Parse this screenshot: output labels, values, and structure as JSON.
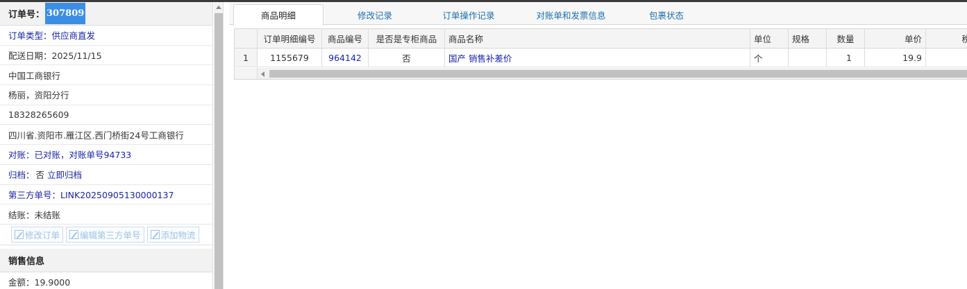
{
  "order": {
    "label": "订单号：",
    "number": "307809"
  },
  "info": [
    {
      "text": "订单类型：供应商直发",
      "style": "blue"
    },
    {
      "text": "配送日期：2025/11/15",
      "style": "normal"
    },
    {
      "text": "中国工商银行",
      "style": "normal"
    },
    {
      "text": "杨丽，资阳分行",
      "style": "normal"
    },
    {
      "text": "18328265609",
      "style": "normal"
    },
    {
      "text": "四川省.资阳市.雁江区.西门桥街24号工商银行",
      "style": "normal"
    },
    {
      "text": "对账：已对账，对账单号94733",
      "style": "blue"
    }
  ],
  "archive": {
    "label": "归档：",
    "value": "否",
    "link": "立即归档"
  },
  "third_party": {
    "text": "第三方单号：LINK20250905130000137"
  },
  "settle": {
    "text": "结账：未结账"
  },
  "buttons": {
    "edit_order": "修改订单",
    "edit_third": "编辑第三方单号",
    "add_logistics": "添加物流"
  },
  "sales": {
    "title": "销售信息",
    "amount": "金额：19.9000"
  },
  "tabs": [
    "商品明细",
    "修改记录",
    "订单操作记录",
    "对账单和发票信息",
    "包裹状态"
  ],
  "grid": {
    "headers": [
      "",
      "订单明细编号",
      "商品编号",
      "是否是专柜商品",
      "商品名称",
      "单位",
      "规格",
      "数量",
      "单价",
      "稅"
    ],
    "row": [
      "1",
      "1155679",
      "964142",
      "否",
      "国产 销售补差价",
      "个",
      "",
      "1",
      "19.9",
      ""
    ]
  }
}
